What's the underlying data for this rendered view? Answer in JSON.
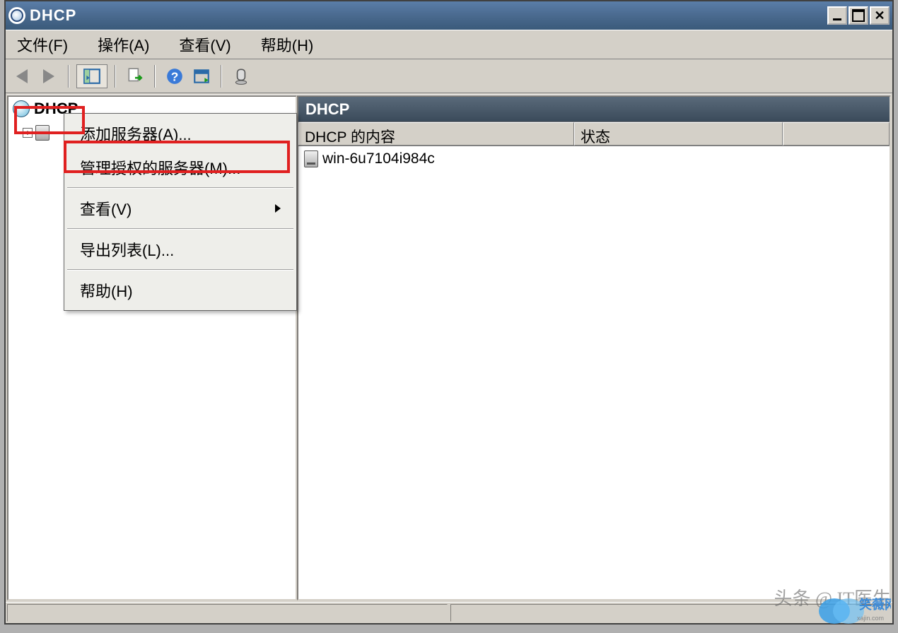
{
  "window": {
    "title": "DHCP"
  },
  "menubar": {
    "file": "文件(F)",
    "action": "操作(A)",
    "view": "查看(V)",
    "help": "帮助(H)"
  },
  "tree": {
    "root_label": "DHCP",
    "child_expander": "+"
  },
  "context_menu": {
    "add_server": "添加服务器(A)...",
    "manage_authorized": "管理授权的服务器(M)...",
    "view": "查看(V)",
    "export_list": "导出列表(L)...",
    "help": "帮助(H)"
  },
  "list": {
    "header": "DHCP",
    "col_content": "DHCP 的内容",
    "col_status": "状态",
    "rows": [
      {
        "name": "win-6u7104i984c"
      }
    ]
  },
  "watermark": "头条 @ IT医生",
  "watermark2": "笑薇网"
}
